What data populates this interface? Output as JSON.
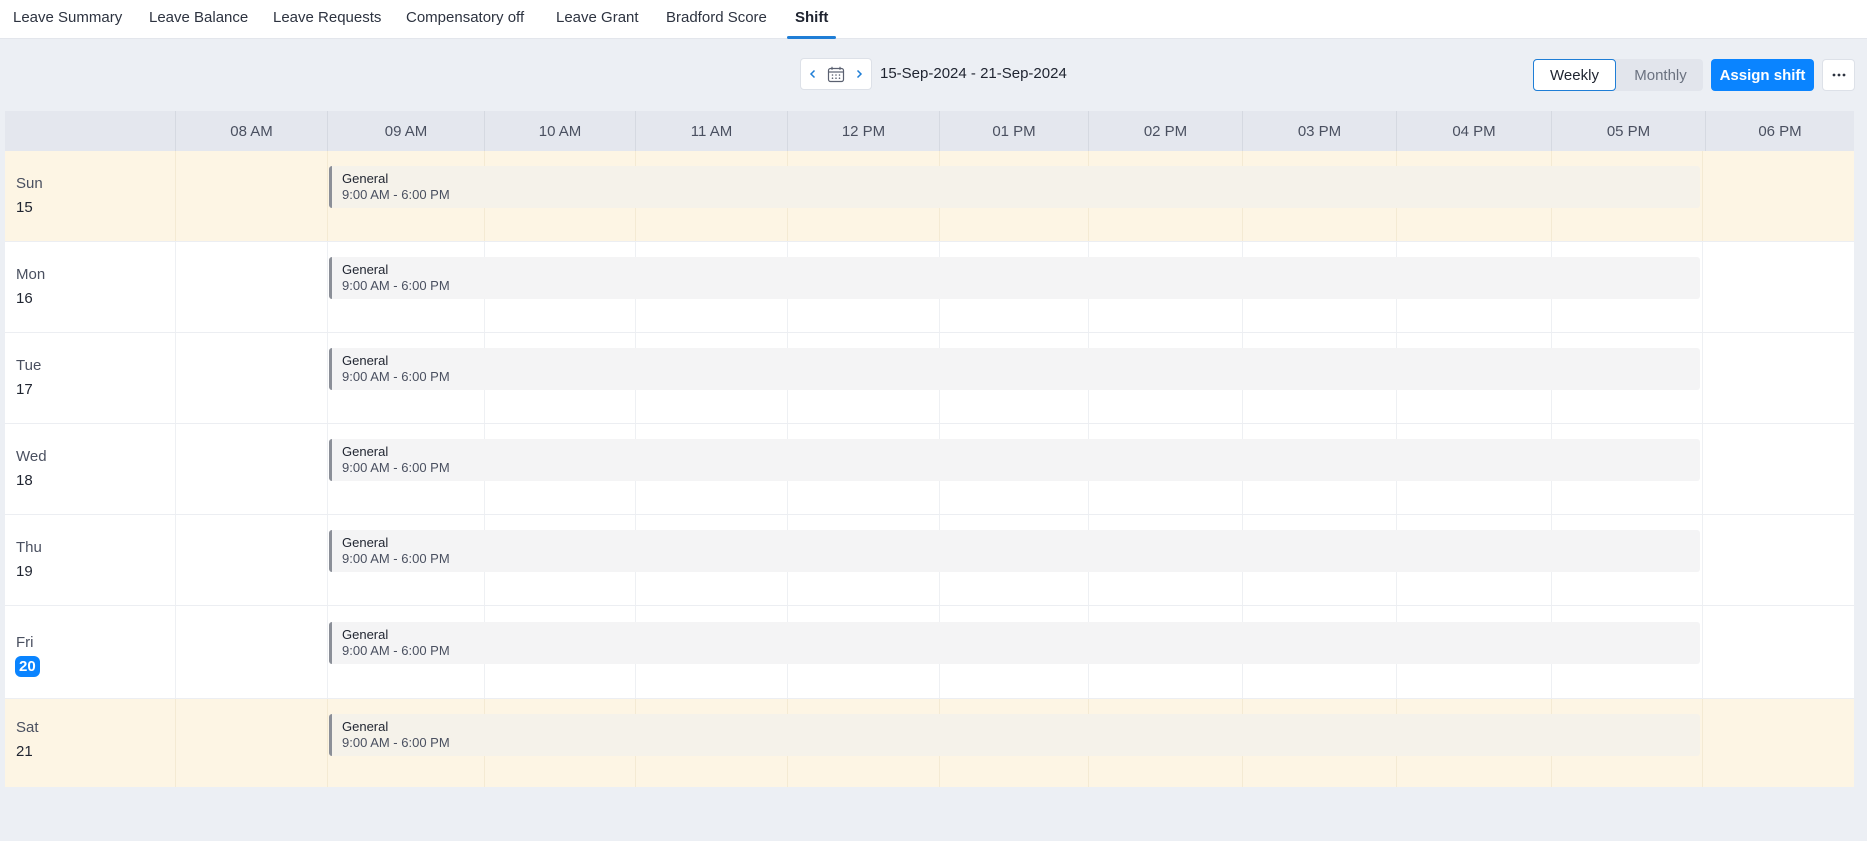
{
  "tabs": [
    {
      "label": "Leave Summary"
    },
    {
      "label": "Leave Balance"
    },
    {
      "label": "Leave Requests"
    },
    {
      "label": "Compensatory off"
    },
    {
      "label": "Leave Grant"
    },
    {
      "label": "Bradford Score"
    },
    {
      "label": "Shift",
      "active": true
    }
  ],
  "toolbar": {
    "date_range": "15-Sep-2024 - 21-Sep-2024",
    "view_weekly": "Weekly",
    "view_monthly": "Monthly",
    "selected_view": "Weekly",
    "assign_label": "Assign shift",
    "more_label": "···"
  },
  "time_columns": [
    "08 AM",
    "09 AM",
    "10 AM",
    "11 AM",
    "12 PM",
    "01 PM",
    "02 PM",
    "03 PM",
    "04 PM",
    "05 PM",
    "06 PM"
  ],
  "days": [
    {
      "name": "Sun",
      "num": "15",
      "weekend": true,
      "today": false,
      "shift": {
        "name": "General",
        "time": "9:00 AM - 6:00 PM"
      }
    },
    {
      "name": "Mon",
      "num": "16",
      "weekend": false,
      "today": false,
      "shift": {
        "name": "General",
        "time": "9:00 AM - 6:00 PM"
      }
    },
    {
      "name": "Tue",
      "num": "17",
      "weekend": false,
      "today": false,
      "shift": {
        "name": "General",
        "time": "9:00 AM - 6:00 PM"
      }
    },
    {
      "name": "Wed",
      "num": "18",
      "weekend": false,
      "today": false,
      "shift": {
        "name": "General",
        "time": "9:00 AM - 6:00 PM"
      }
    },
    {
      "name": "Thu",
      "num": "19",
      "weekend": false,
      "today": false,
      "shift": {
        "name": "General",
        "time": "9:00 AM - 6:00 PM"
      }
    },
    {
      "name": "Fri",
      "num": "20",
      "weekend": false,
      "today": true,
      "shift": {
        "name": "General",
        "time": "9:00 AM - 6:00 PM"
      }
    },
    {
      "name": "Sat",
      "num": "21",
      "weekend": true,
      "today": false,
      "shift": {
        "name": "General",
        "time": "9:00 AM - 6:00 PM"
      }
    }
  ],
  "colors": {
    "accent": "#0a84ff",
    "weekend_bg": "#fdf5e4",
    "header_bg": "#e4e7ee",
    "shift_bg": "#f4f4f5",
    "shift_border": "#8b8f98"
  }
}
